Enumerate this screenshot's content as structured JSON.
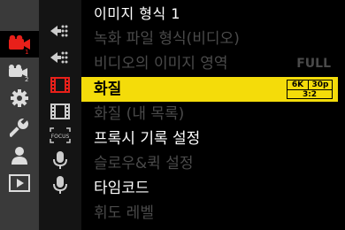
{
  "title": "이미지 형식 1",
  "menu_items": [
    {
      "label": "녹화 파일 형식(비디오)",
      "state": "disabled",
      "value": ""
    },
    {
      "label": "비디오의 이미지 영역",
      "state": "disabled",
      "value": "FULL"
    },
    {
      "label": "화질",
      "state": "selected",
      "value": ""
    },
    {
      "label": "화질 (내 목록)",
      "state": "disabled",
      "value": ""
    },
    {
      "label": "프록시 기록 설정",
      "state": "enabled",
      "value": ""
    },
    {
      "label": "슬로우&퀵 설정",
      "state": "disabled",
      "value": ""
    },
    {
      "label": "타임코드",
      "state": "enabled",
      "value": ""
    },
    {
      "label": "휘도 레벨",
      "state": "disabled",
      "value": ""
    }
  ],
  "quality_badge": {
    "resolution": "6K",
    "frame_rate": "30p",
    "aspect": "3:2"
  },
  "category_tabs": [
    {
      "name": "video-camera-1-icon",
      "number": "1",
      "active": true
    },
    {
      "name": "video-camera-2-icon",
      "number": "2",
      "active": false
    },
    {
      "name": "gear-icon",
      "active": false
    },
    {
      "name": "wrench-icon",
      "active": false
    },
    {
      "name": "person-icon",
      "active": false
    },
    {
      "name": "playback-icon",
      "active": false
    }
  ],
  "subcategory_tabs": [
    {
      "name": "image-format-1-icon"
    },
    {
      "name": "image-format-2-icon"
    },
    {
      "name": "film-1-icon",
      "active": true
    },
    {
      "name": "film-2-icon"
    },
    {
      "name": "focus-icon",
      "label": "FOCUS"
    },
    {
      "name": "microphone-1-icon"
    },
    {
      "name": "microphone-2-icon"
    }
  ],
  "colors": {
    "accent_red": "#e8201a",
    "highlight_yellow": "#f4dc0a",
    "disabled_gray": "#4a4a4a"
  }
}
